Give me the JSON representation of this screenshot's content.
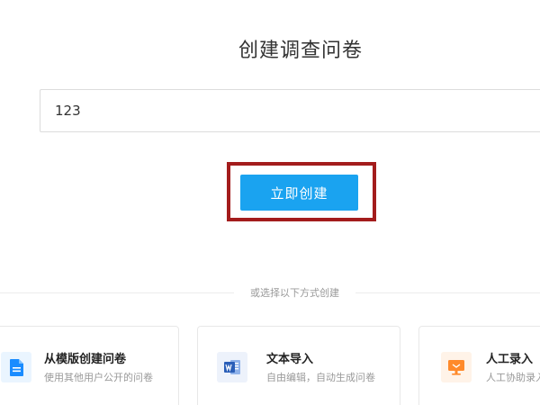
{
  "header": {
    "title": "创建调查问卷"
  },
  "form": {
    "name_value": "123"
  },
  "actions": {
    "create_label": "立即创建"
  },
  "divider": {
    "text": "或选择以下方式创建"
  },
  "options": [
    {
      "title": "从模版创建问卷",
      "desc": "使用其他用户公开的问卷",
      "icon": "document-icon",
      "color": "#1a8cff"
    },
    {
      "title": "文本导入",
      "desc": "自由编辑，自动生成问卷",
      "icon": "word-doc-icon",
      "color": "#2b5fb8"
    },
    {
      "title": "人工录入",
      "desc": "人工协助录入",
      "icon": "monitor-icon",
      "color": "#ff8a2b"
    }
  ],
  "colors": {
    "primary": "#1aa3f0",
    "highlight_border": "#a31c1c"
  }
}
